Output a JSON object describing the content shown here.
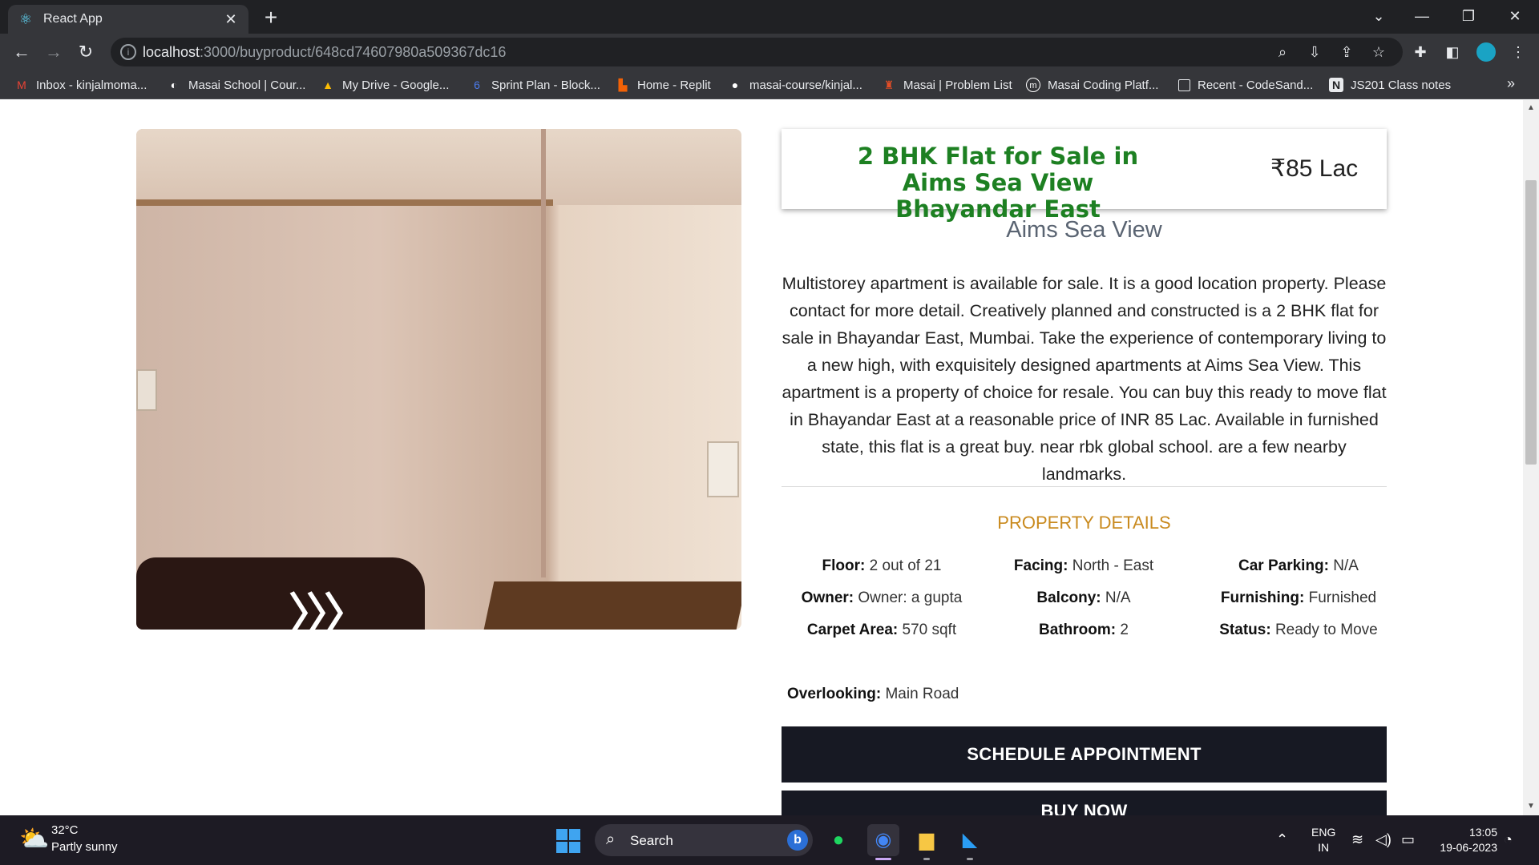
{
  "browser": {
    "tab_title": "React App",
    "url_host": "localhost",
    "url_path": ":3000/buyproduct/648cd74607980a509367dc16",
    "bookmarks": [
      {
        "label": "Inbox - kinjalmoma...",
        "icon": "gmail-icon"
      },
      {
        "label": "Masai School | Cour...",
        "icon": "masai-icon"
      },
      {
        "label": "My Drive - Google...",
        "icon": "google-drive-icon"
      },
      {
        "label": "Sprint Plan - Block...",
        "icon": "block-icon"
      },
      {
        "label": "Home - Replit",
        "icon": "replit-icon"
      },
      {
        "label": "masai-course/kinjal...",
        "icon": "github-icon"
      },
      {
        "label": "Masai | Problem List",
        "icon": "masai-problem-icon"
      },
      {
        "label": "Masai Coding Platf...",
        "icon": "masai-coding-icon"
      },
      {
        "label": "Recent - CodeSand...",
        "icon": "codesandbox-icon"
      },
      {
        "label": "JS201 Class notes",
        "icon": "notion-icon"
      }
    ]
  },
  "property": {
    "title": "2 BHK Flat for Sale in Aims Sea View Bhayandar East",
    "price": "₹85 Lac",
    "project": "Aims Sea View",
    "description": "Multistorey apartment is available for sale. It is a good location property. Please contact for more detail. Creatively planned and constructed is a 2 BHK flat for sale in Bhayandar East, Mumbai. Take the experience of contemporary living to a new high, with exquisitely designed apartments at Aims Sea View. This apartment is a property of choice for resale. You can buy this ready to move flat in Bhayandar East at a reasonable price of INR 85 Lac. Available in furnished state, this flat is a great buy. near rbk global school. are a few nearby landmarks.",
    "details_heading": "PROPERTY DETAILS",
    "details": {
      "floor": {
        "label": "Floor:",
        "value": "2 out of 21"
      },
      "facing": {
        "label": "Facing:",
        "value": "North - East"
      },
      "car_parking": {
        "label": "Car Parking:",
        "value": "N/A"
      },
      "owner": {
        "label": "Owner:",
        "value": "Owner: a gupta"
      },
      "balcony": {
        "label": "Balcony:",
        "value": "N/A"
      },
      "furnishing": {
        "label": "Furnishing:",
        "value": "Furnished"
      },
      "carpet_area": {
        "label": "Carpet Area:",
        "value": "570 sqft"
      },
      "bathroom": {
        "label": "Bathroom:",
        "value": "2"
      },
      "status": {
        "label": "Status:",
        "value": "Ready to Move"
      },
      "overlooking": {
        "label": "Overlooking:",
        "value": "Main Road"
      }
    },
    "schedule_label": "SCHEDULE APPOINTMENT",
    "buy_label": "BUY NOW"
  },
  "taskbar": {
    "temperature": "32°C",
    "condition": "Partly sunny",
    "search_label": "Search",
    "language": "ENG",
    "region": "IN",
    "time": "13:05",
    "date": "19-06-2023"
  },
  "colors": {
    "title_green": "#1d8022",
    "section_gold": "#c98a1e",
    "button_dark": "#171923"
  }
}
